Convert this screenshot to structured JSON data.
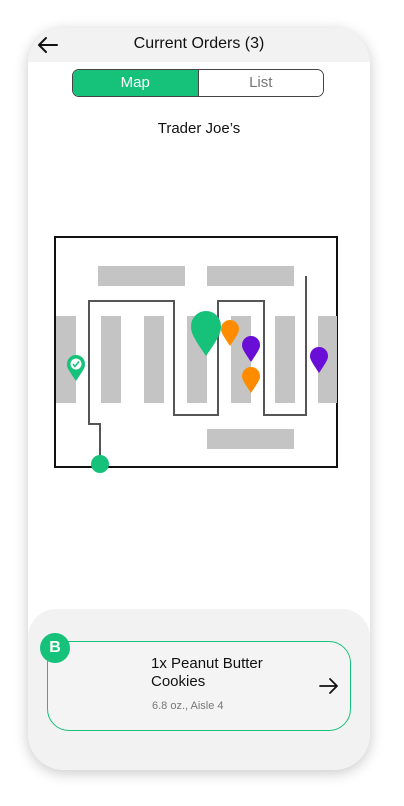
{
  "header": {
    "title": "Current Orders (3)",
    "back_icon": "back-arrow-icon"
  },
  "view_toggle": {
    "options": [
      "Map",
      "List"
    ],
    "selected": "Map"
  },
  "store_name": "Trader Joe’s",
  "map": {
    "icons": [
      "start-dot-icon",
      "completed-check-pin-icon",
      "current-item-pin-icon",
      "orange-pin-icon",
      "purple-pin-icon"
    ],
    "colors": {
      "route": "#555555",
      "shelf": "#c4c4c4",
      "green": "#16c27a",
      "orange": "#ff8c00",
      "purple": "#6a0dd6"
    }
  },
  "current_item": {
    "badge": "B",
    "name": "1x Peanut Butter Cookies",
    "detail": "6.8 oz., Aisle 4",
    "arrow_icon": "arrow-right-icon"
  }
}
